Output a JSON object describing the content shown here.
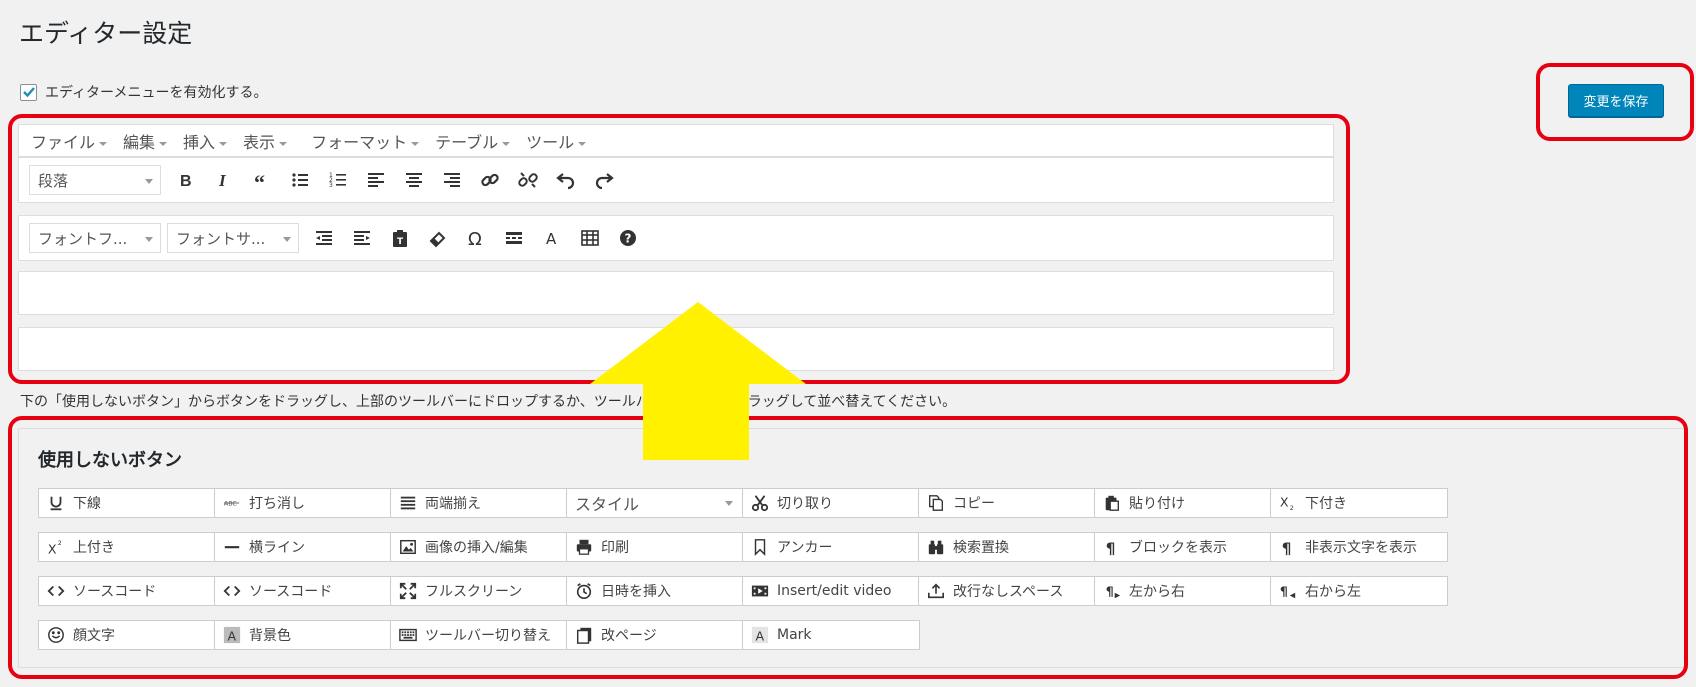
{
  "page_title": "エディター設定",
  "enable_menu_label": "エディターメニューを有効化する。",
  "save_button": "変更を保存",
  "menubar": [
    "ファイル",
    "編集",
    "挿入",
    "表示",
    "フォーマット",
    "テーブル",
    "ツール"
  ],
  "toolbar1": {
    "format_select": "段落",
    "buttons": [
      "bold-icon",
      "italic-icon",
      "blockquote-icon",
      "bullet-list-icon",
      "numbered-list-icon",
      "align-left-icon",
      "align-center-icon",
      "align-right-icon",
      "link-icon",
      "unlink-icon",
      "undo-icon",
      "redo-icon"
    ]
  },
  "toolbar2": {
    "font_family_select": "フォントフ...",
    "font_size_select": "フォントサ...",
    "buttons": [
      "outdent-icon",
      "indent-icon",
      "paste-text-icon",
      "eraser-icon",
      "omega-icon",
      "horizontal-rule-icon",
      "text-color-icon",
      "table-icon",
      "help-icon"
    ]
  },
  "instructions": "下の「使用しないボタン」からボタンをドラッグし、上部のツールバーにドロップするか、ツールバーのボタンをドラッグして並べ替えてください。",
  "unused_title": "使用しないボタン",
  "unused_buttons": [
    {
      "label": "下線",
      "icon": "underline-icon"
    },
    {
      "label": "打ち消し",
      "icon": "strikethrough-icon"
    },
    {
      "label": "両端揃え",
      "icon": "justify-icon"
    },
    {
      "label": "スタイル",
      "icon": "",
      "select": true
    },
    {
      "label": "切り取り",
      "icon": "scissors-icon"
    },
    {
      "label": "コピー",
      "icon": "copy-icon"
    },
    {
      "label": "貼り付け",
      "icon": "paste-icon"
    },
    {
      "label": "下付き",
      "icon": "subscript-icon"
    },
    {
      "label": "上付き",
      "icon": "superscript-icon"
    },
    {
      "label": "横ライン",
      "icon": "hline-icon"
    },
    {
      "label": "画像の挿入/編集",
      "icon": "image-icon"
    },
    {
      "label": "印刷",
      "icon": "print-icon"
    },
    {
      "label": "アンカー",
      "icon": "bookmark-icon"
    },
    {
      "label": "検索置換",
      "icon": "binoculars-icon"
    },
    {
      "label": "ブロックを表示",
      "icon": "pilcrow-icon"
    },
    {
      "label": "非表示文字を表示",
      "icon": "pilcrow-icon"
    },
    {
      "label": "ソースコード",
      "icon": "code-icon"
    },
    {
      "label": "ソースコード",
      "icon": "code-icon"
    },
    {
      "label": "フルスクリーン",
      "icon": "fullscreen-icon"
    },
    {
      "label": "日時を挿入",
      "icon": "clock-icon"
    },
    {
      "label": "Insert/edit video",
      "icon": "video-icon"
    },
    {
      "label": "改行なしスペース",
      "icon": "nbsp-icon"
    },
    {
      "label": "左から右",
      "icon": "ltr-icon"
    },
    {
      "label": "右から左",
      "icon": "rtl-icon"
    },
    {
      "label": "顔文字",
      "icon": "smiley-icon"
    },
    {
      "label": "背景色",
      "icon": "background-color-icon"
    },
    {
      "label": "ツールバー切り替え",
      "icon": "keyboard-icon"
    },
    {
      "label": "改ページ",
      "icon": "page-break-icon"
    },
    {
      "label": "Mark",
      "icon": "mark-icon"
    }
  ],
  "colors": {
    "highlight_frame": "#e60012",
    "arrow": "#fff100",
    "primary_button": "#0085ba"
  }
}
